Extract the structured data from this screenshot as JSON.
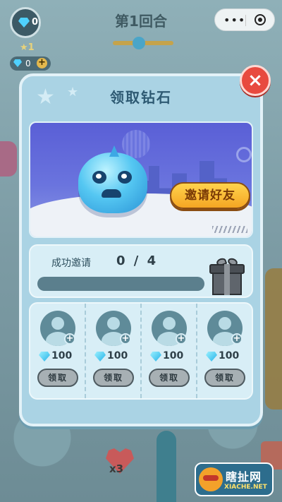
{
  "background": {
    "round_title": "第1回合",
    "avatar_gem_count": "0",
    "level": "1",
    "gem_balance": "0",
    "add_symbol": "+",
    "lives_multiplier": "x3"
  },
  "mini_program_bar": {
    "menu_dots": "•••"
  },
  "modal": {
    "title": "领取钻石",
    "close_symbol": "×",
    "invite_button_label": "邀请好友",
    "progress_label": "成功邀请",
    "progress_count": "0 / 4",
    "progress_fraction": 0.0,
    "rewards": [
      {
        "amount": "100",
        "claim_label": "领取"
      },
      {
        "amount": "100",
        "claim_label": "领取"
      },
      {
        "amount": "100",
        "claim_label": "领取"
      },
      {
        "amount": "100",
        "claim_label": "领取"
      }
    ],
    "add_symbol": "+"
  },
  "watermark": {
    "name": "瞎扯网",
    "domain": "XIACHE.NET"
  },
  "colors": {
    "modal_bg": "#aad3e4",
    "close_button": "#e84a3f",
    "invite_button": "#f5a623",
    "gem": "#4fd1ff",
    "progress_fill": "#f2c94c"
  }
}
